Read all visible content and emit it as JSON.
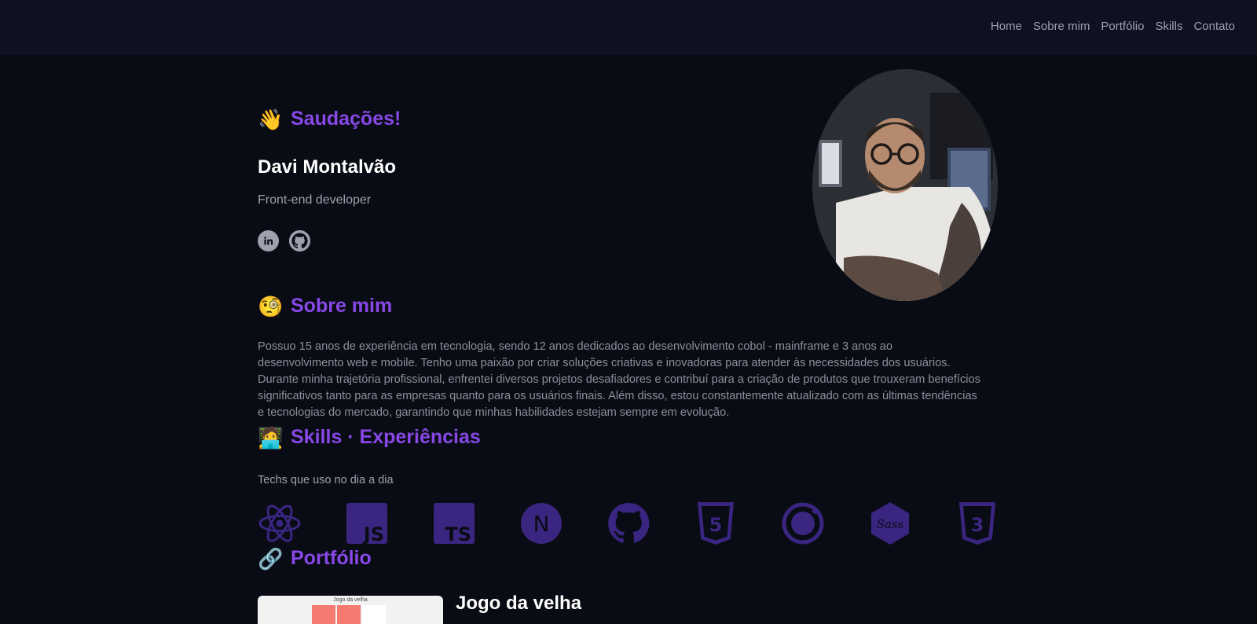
{
  "nav": {
    "items": [
      "Home",
      "Sobre mim",
      "Portfólio",
      "Skills",
      "Contato"
    ]
  },
  "hero": {
    "greeting_emoji": "👋",
    "greeting": "Saudações!",
    "name": "Davi Montalvão",
    "role": "Front-end developer",
    "socials": [
      "linkedin-icon",
      "github-icon"
    ],
    "avatar": "profile-photo"
  },
  "about": {
    "emoji": "🧐",
    "title": "Sobre mim",
    "text": "Possuo 15 anos de experiência em tecnologia, sendo 12 anos dedicados ao desenvolvimento cobol - mainframe e 3 anos ao desenvolvimento web e mobile. Tenho uma paixão por criar soluções criativas e inovadoras para atender às necessidades dos usuários. Durante minha trajetória profissional, enfrentei diversos projetos desafiadores e contribuí para a criação de produtos que trouxeram benefícios significativos tanto para as empresas quanto para os usuários finais. Além disso, estou constantemente atualizado com as últimas tendências e tecnologias do mercado, garantindo que minhas habilidades estejam sempre em evolução."
  },
  "skills": {
    "emoji": "🧑‍💻",
    "title": "Skills · Experiências",
    "subtitle": "Techs que uso no dia a dia",
    "icons": [
      "react-icon",
      "javascript-icon",
      "typescript-icon",
      "nextjs-icon",
      "github-icon",
      "html5-icon",
      "ionic-icon",
      "sass-icon",
      "css3-icon"
    ],
    "icon_labels": {
      "javascript": "JS",
      "typescript": "TS",
      "nextjs": "N",
      "sass": "Sass",
      "html5": "5",
      "css3": "3"
    }
  },
  "portfolio": {
    "emoji": "🔗",
    "title": "Portfólio",
    "projects": [
      {
        "title": "Jogo da velha",
        "thumb_title": "Jogo da velha",
        "thumb_marks": [
          "x",
          "x"
        ]
      }
    ]
  },
  "colors": {
    "accent": "#8848e8",
    "icon": "#3a2580",
    "background": "#090c14",
    "nav": "#0e1120"
  }
}
